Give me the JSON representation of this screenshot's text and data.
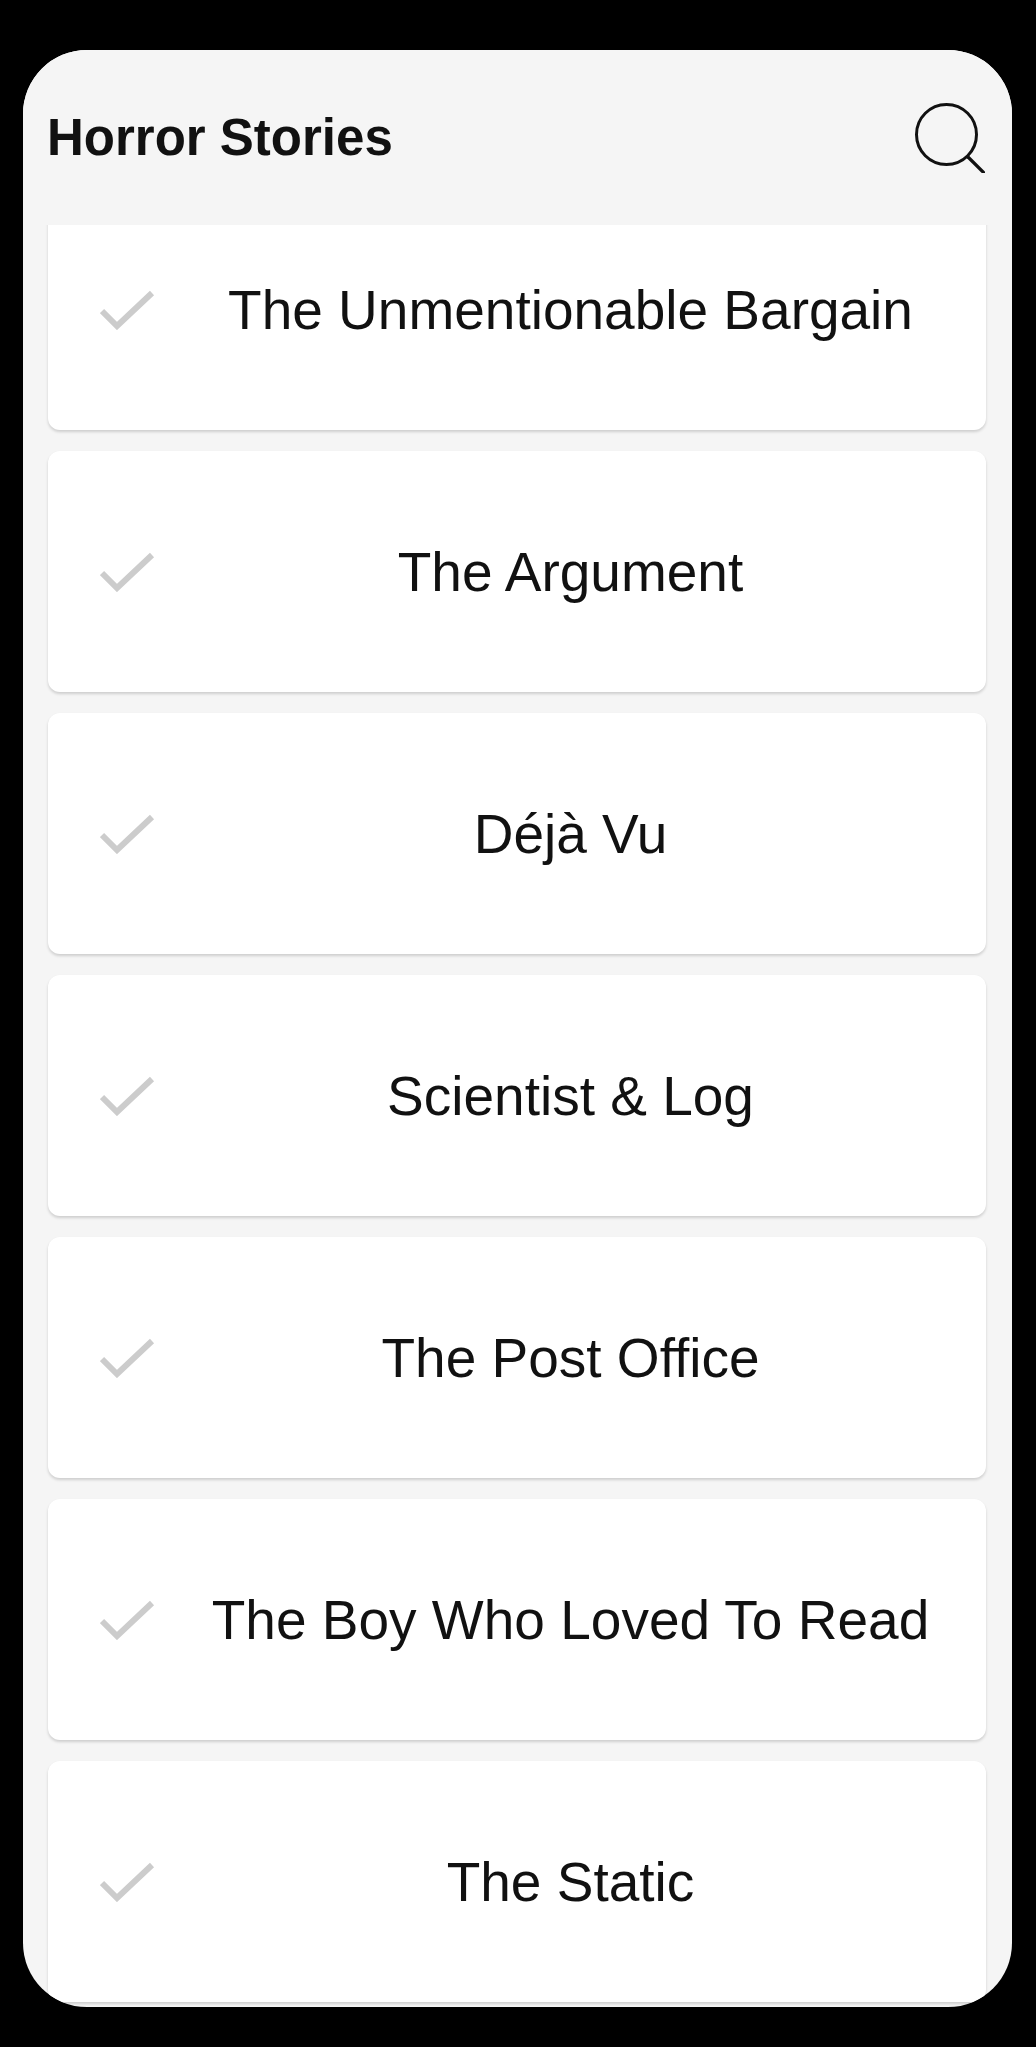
{
  "app_bar": {
    "title": "Horror Stories"
  },
  "stories": [
    {
      "title": "The Unmentionable Bargain",
      "read": false
    },
    {
      "title": "The Argument",
      "read": false
    },
    {
      "title": "Déjà Vu",
      "read": false
    },
    {
      "title": "Scientist & Log",
      "read": false
    },
    {
      "title": "The Post Office",
      "read": false
    },
    {
      "title": "The Boy Who Loved To Read",
      "read": false
    },
    {
      "title": "The Static",
      "read": false
    }
  ]
}
